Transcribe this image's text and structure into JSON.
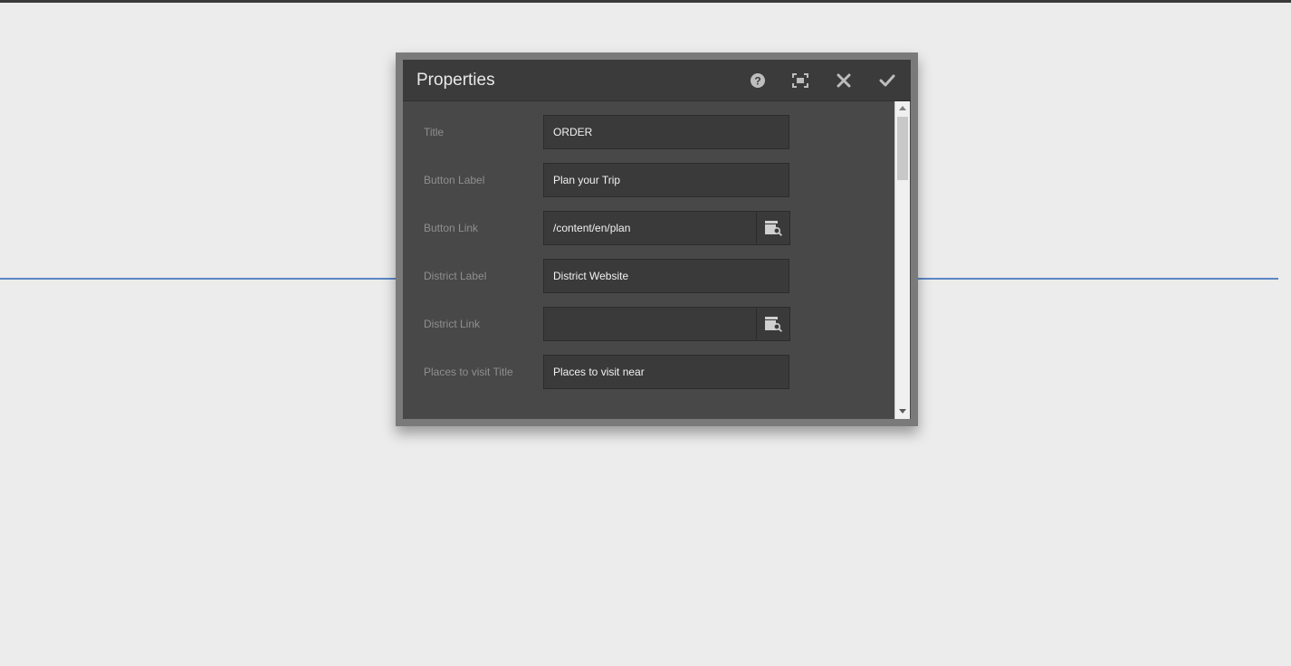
{
  "dialog": {
    "title": "Properties",
    "header_icons": {
      "help": "help-icon",
      "fullscreen": "fullscreen-icon",
      "close": "close-icon",
      "done": "check-icon"
    }
  },
  "form": {
    "title": {
      "label": "Title",
      "value": "ORDER"
    },
    "button_label": {
      "label": "Button Label",
      "value": "Plan your Trip"
    },
    "button_link": {
      "label": "Button Link",
      "value": "/content/en/plan"
    },
    "district_label": {
      "label": "District Label",
      "value": "District Website"
    },
    "district_link": {
      "label": "District Link",
      "value": ""
    },
    "places_title": {
      "label": "Places to visit Title",
      "value": "Places to visit near"
    }
  },
  "colors": {
    "background": "#ececec",
    "dialog_body": "#484848",
    "dialog_header": "#3b3b3b",
    "guide_line": "#5b86c5"
  }
}
